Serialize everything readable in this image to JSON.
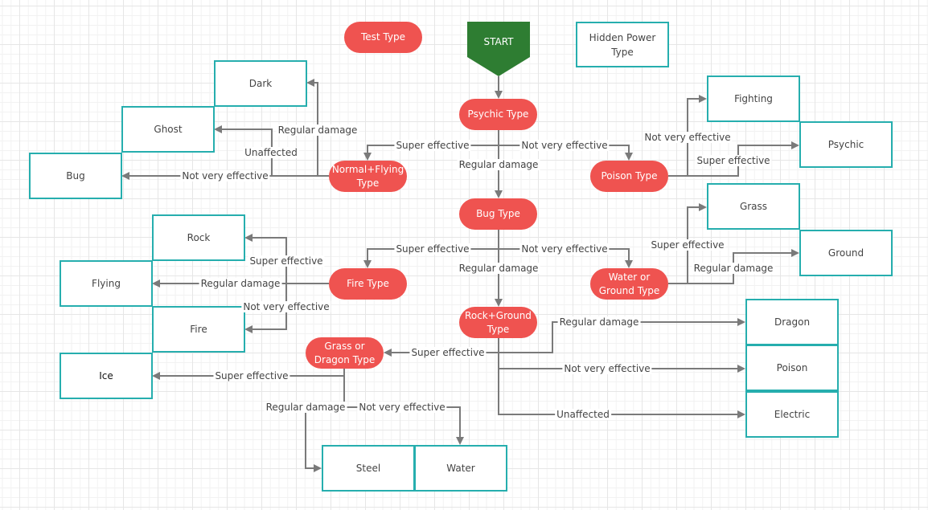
{
  "colors": {
    "decision": "#ef5350",
    "start": "#2e7d32",
    "result_border": "#26aeae",
    "edge": "#7a7a7a"
  },
  "legend": {
    "test_type": "Test Type",
    "hidden_power_type": "Hidden Power\nType"
  },
  "start": "START",
  "decisions": {
    "psychic": "Psychic Type",
    "normal_flying": "Normal+Flying\nType",
    "poison": "Poison Type",
    "bug": "Bug Type",
    "fire": "Fire Type",
    "water_ground": "Water or\nGround Type",
    "rock_ground": "Rock+Ground\nType",
    "grass_dragon": "Grass or\nDragon Type"
  },
  "results": {
    "dark": "Dark",
    "ghost": "Ghost",
    "bug": "Bug",
    "rock": "Rock",
    "flying": "Flying",
    "fire": "Fire",
    "ice": "Ice",
    "fighting": "Fighting",
    "psychic": "Psychic",
    "grass": "Grass",
    "ground": "Ground",
    "dragon": "Dragon",
    "poison": "Poison",
    "electric": "Electric",
    "steel": "Steel",
    "water": "Water"
  },
  "edge_labels": {
    "super": "Super effective",
    "not_very": "Not very effective",
    "regular": "Regular damage",
    "unaffected": "Unaffected"
  }
}
